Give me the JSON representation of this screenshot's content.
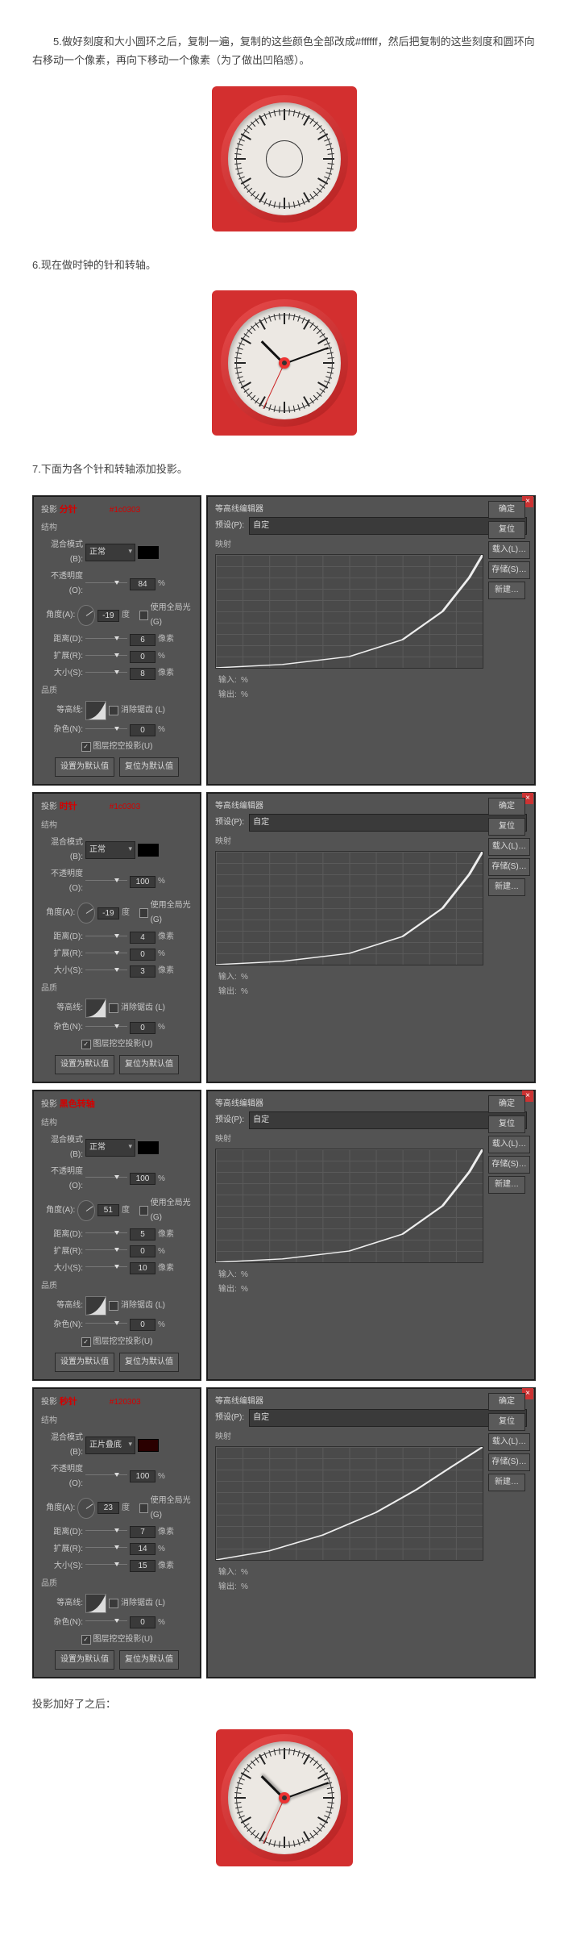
{
  "step5": "5.做好刻度和大小圆环之后，复制一遍，复制的这些颜色全部改成#ffffff，然后把复制的这些刻度和圆环向右移动一个像素，再向下移动一个像素（为了做出凹陷感）。",
  "step6": "6.现在做时钟的针和转轴。",
  "step7": "7.下面为各个针和转轴添加投影。",
  "result_text": "投影加好了之后：",
  "common": {
    "shadow": "投影",
    "structure": "结构",
    "blend_label": "混合模式(B):",
    "opacity_label": "不透明度(O):",
    "angle_label": "角度(A):",
    "deg": "度",
    "global_light": "使用全局光(G)",
    "distance_label": "距离(D):",
    "spread_label": "扩展(R):",
    "size_label": "大小(S):",
    "px": "像素",
    "pct": "%",
    "quality": "品质",
    "contour_label": "等高线:",
    "anti_alias": "消除锯齿 (L)",
    "noise_label": "杂色(N):",
    "knockout": "图层挖空投影(U)",
    "make_default": "设置为默认值",
    "reset_default": "复位为默认值",
    "editor_title": "等高线编辑器",
    "preset_label": "预设(P):",
    "preset_value": "自定",
    "mapping": "映射",
    "ok": "确定",
    "reset": "复位",
    "load": "载入(L)…",
    "save": "存储(S)…",
    "new": "新建…",
    "input": "输入:",
    "output": "输出:"
  },
  "panels": [
    {
      "name": "分针",
      "tag": "#1c0303",
      "blend": "正常",
      "op": "84",
      "ang": "-19",
      "dist": "6",
      "spr": "0",
      "size": "8",
      "noise": "0"
    },
    {
      "name": "时针",
      "tag": "#1c0303",
      "blend": "正常",
      "op": "100",
      "ang": "-19",
      "dist": "4",
      "spr": "0",
      "size": "3",
      "noise": "0"
    },
    {
      "name": "黑色转轴",
      "tag": "",
      "blend": "正常",
      "op": "100",
      "ang": "51",
      "dist": "5",
      "spr": "0",
      "size": "10",
      "noise": "0"
    },
    {
      "name": "秒针",
      "tag": "#120303",
      "blend": "正片叠底",
      "op": "100",
      "ang": "23",
      "dist": "7",
      "spr": "14",
      "size": "15",
      "noise": "0"
    }
  ],
  "chart_data": [
    {
      "type": "line",
      "title": "等高线 分针",
      "xlabel": "输入",
      "ylabel": "输出",
      "xlim": [
        0,
        100
      ],
      "ylim": [
        0,
        100
      ],
      "series": [
        {
          "name": "curve",
          "x": [
            0,
            25,
            50,
            70,
            85,
            95,
            100
          ],
          "y": [
            0,
            3,
            10,
            25,
            50,
            80,
            100
          ]
        }
      ]
    },
    {
      "type": "line",
      "title": "等高线 时针",
      "xlabel": "输入",
      "ylabel": "输出",
      "xlim": [
        0,
        100
      ],
      "ylim": [
        0,
        100
      ],
      "series": [
        {
          "name": "curve",
          "x": [
            0,
            25,
            50,
            70,
            85,
            95,
            100
          ],
          "y": [
            0,
            3,
            10,
            25,
            50,
            80,
            100
          ]
        }
      ]
    },
    {
      "type": "line",
      "title": "等高线 黑色转轴",
      "xlabel": "输入",
      "ylabel": "输出",
      "xlim": [
        0,
        100
      ],
      "ylim": [
        0,
        100
      ],
      "series": [
        {
          "name": "curve",
          "x": [
            0,
            25,
            50,
            70,
            85,
            95,
            100
          ],
          "y": [
            0,
            3,
            10,
            25,
            50,
            80,
            100
          ]
        }
      ]
    },
    {
      "type": "line",
      "title": "等高线 秒针",
      "xlabel": "输入",
      "ylabel": "输出",
      "xlim": [
        0,
        100
      ],
      "ylim": [
        0,
        100
      ],
      "series": [
        {
          "name": "curve",
          "x": [
            0,
            20,
            40,
            60,
            75,
            88,
            100
          ],
          "y": [
            0,
            8,
            22,
            42,
            62,
            82,
            100
          ]
        }
      ]
    }
  ]
}
